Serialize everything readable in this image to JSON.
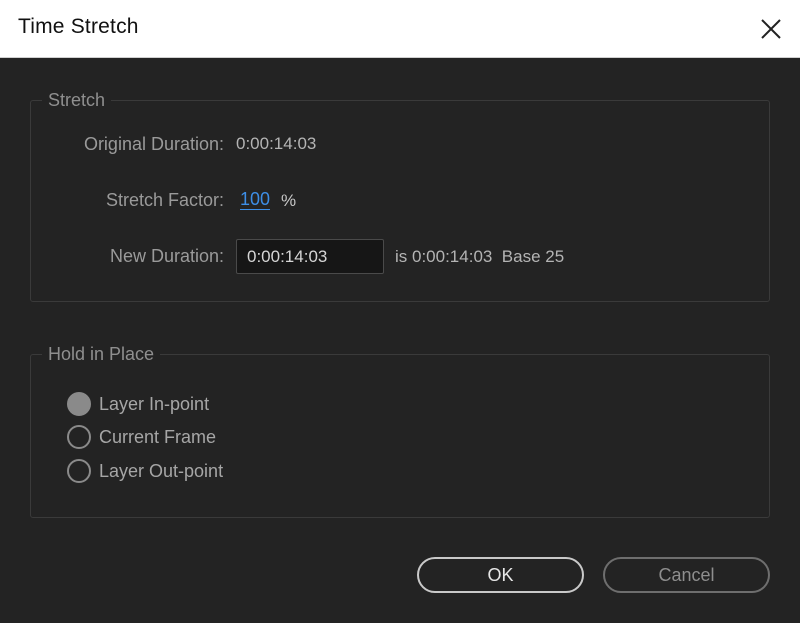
{
  "window": {
    "title": "Time Stretch"
  },
  "stretch": {
    "group_label": "Stretch",
    "original_duration_label": "Original Duration:",
    "original_duration_value": "0:00:14:03",
    "stretch_factor_label": "Stretch Factor:",
    "stretch_factor_value": "100",
    "stretch_factor_unit": "%",
    "new_duration_label": "New Duration:",
    "new_duration_value": "0:00:14:03",
    "new_duration_info": "is 0:00:14:03  Base 25"
  },
  "hold_in_place": {
    "group_label": "Hold in Place",
    "options": [
      {
        "label": "Layer In-point",
        "checked": true
      },
      {
        "label": "Current Frame",
        "checked": false
      },
      {
        "label": "Layer Out-point",
        "checked": false
      }
    ]
  },
  "buttons": {
    "ok": "OK",
    "cancel": "Cancel"
  },
  "colors": {
    "background": "#232323",
    "accent_link": "#3d8ee6",
    "titlebar": "#ffffff"
  }
}
